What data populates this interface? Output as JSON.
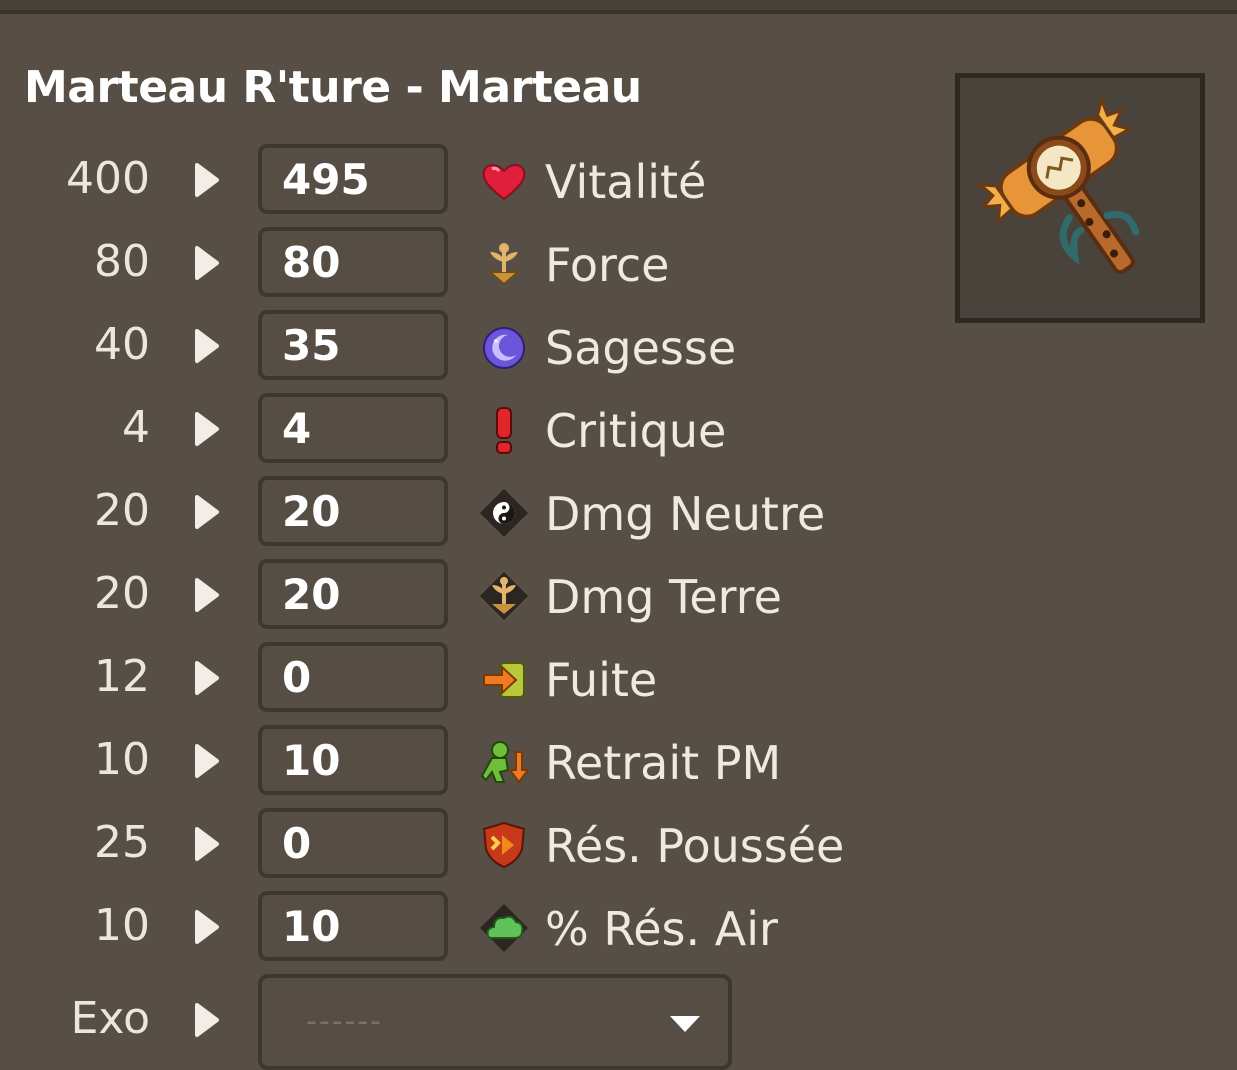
{
  "item": {
    "title": "Marteau R'ture - Marteau",
    "image_name": "hammer-item-icon"
  },
  "stats": [
    {
      "base": "400",
      "value": "495",
      "label": "Vitalité",
      "icon": "heart-icon"
    },
    {
      "base": "80",
      "value": "80",
      "label": "Force",
      "icon": "earth-sprout-icon"
    },
    {
      "base": "40",
      "value": "35",
      "label": "Sagesse",
      "icon": "moon-icon"
    },
    {
      "base": "4",
      "value": "4",
      "label": "Critique",
      "icon": "exclamation-icon"
    },
    {
      "base": "20",
      "value": "20",
      "label": "Dmg Neutre",
      "icon": "yin-yang-icon"
    },
    {
      "base": "20",
      "value": "20",
      "label": "Dmg Terre",
      "icon": "earth-damage-icon"
    },
    {
      "base": "12",
      "value": "0",
      "label": "Fuite",
      "icon": "escape-icon"
    },
    {
      "base": "10",
      "value": "10",
      "label": "Retrait PM",
      "icon": "mp-removal-icon"
    },
    {
      "base": "25",
      "value": "0",
      "label": "Rés. Poussée",
      "icon": "pushback-resist-icon"
    },
    {
      "base": "10",
      "value": "10",
      "label": "% Rés. Air",
      "icon": "air-resist-icon"
    }
  ],
  "exo": {
    "label": "Exo",
    "placeholder": "------"
  },
  "colors": {
    "background": "#574f45",
    "input_border": "#3e3730",
    "text": "#ffffff"
  }
}
